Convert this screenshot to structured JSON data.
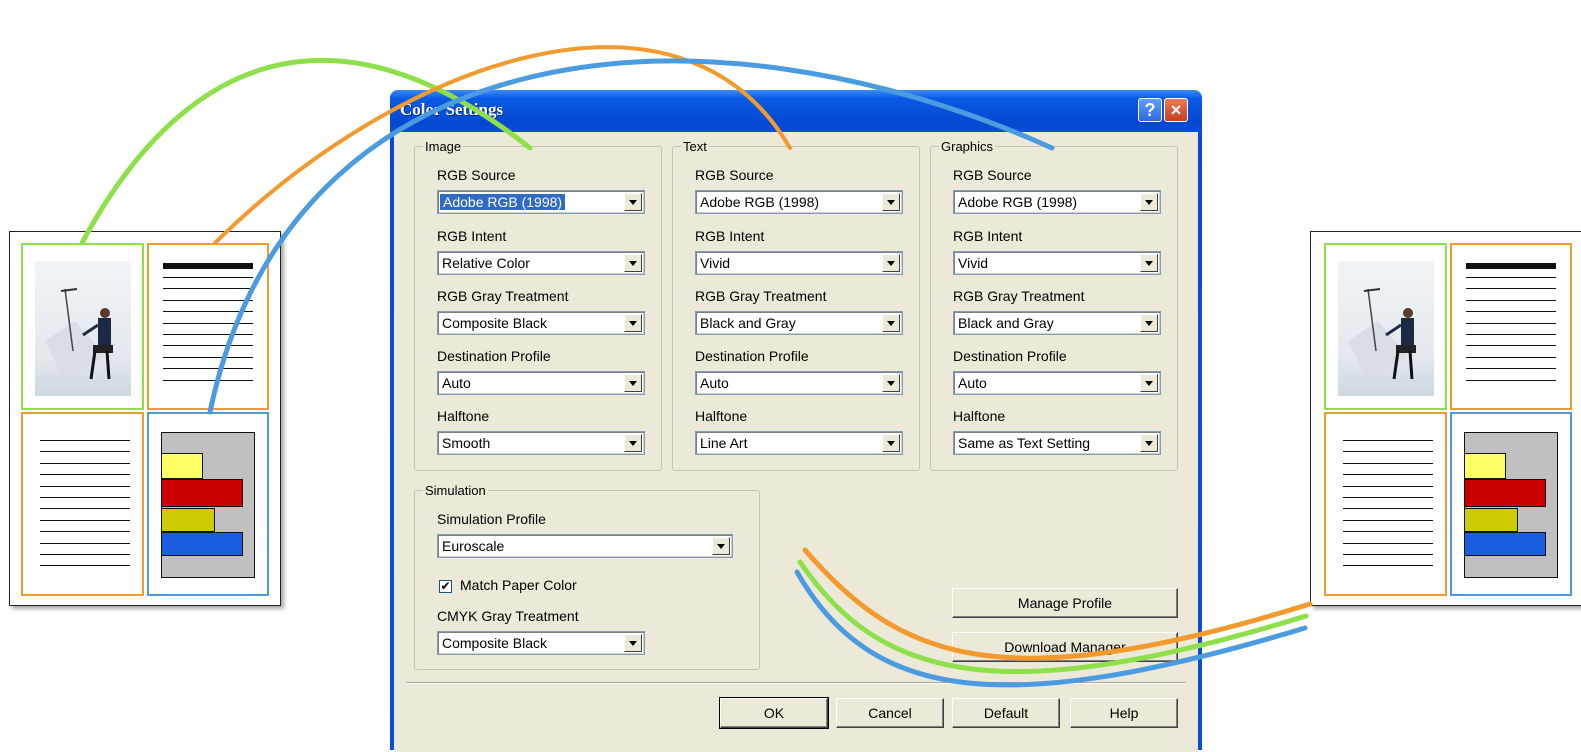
{
  "dialog": {
    "title": "Color Settings",
    "help_icon": "?",
    "close_icon": "×"
  },
  "groups": {
    "image": {
      "legend": "Image",
      "rgb_source_label": "RGB Source",
      "rgb_source_value": "Adobe RGB (1998)",
      "rgb_intent_label": "RGB Intent",
      "rgb_intent_value": "Relative Color",
      "gray_treatment_label": "RGB Gray Treatment",
      "gray_treatment_value": "Composite Black",
      "dest_profile_label": "Destination Profile",
      "dest_profile_value": "Auto",
      "halftone_label": "Halftone",
      "halftone_value": "Smooth"
    },
    "text": {
      "legend": "Text",
      "rgb_source_label": "RGB Source",
      "rgb_source_value": "Adobe RGB (1998)",
      "rgb_intent_label": "RGB Intent",
      "rgb_intent_value": "Vivid",
      "gray_treatment_label": "RGB Gray Treatment",
      "gray_treatment_value": "Black and Gray",
      "dest_profile_label": "Destination Profile",
      "dest_profile_value": "Auto",
      "halftone_label": "Halftone",
      "halftone_value": "Line Art"
    },
    "graphics": {
      "legend": "Graphics",
      "rgb_source_label": "RGB Source",
      "rgb_source_value": "Adobe RGB (1998)",
      "rgb_intent_label": "RGB Intent",
      "rgb_intent_value": "Vivid",
      "gray_treatment_label": "RGB Gray Treatment",
      "gray_treatment_value": "Black and Gray",
      "dest_profile_label": "Destination Profile",
      "dest_profile_value": "Auto",
      "halftone_label": "Halftone",
      "halftone_value": "Same as Text Setting"
    },
    "simulation": {
      "legend": "Simulation",
      "profile_label": "Simulation Profile",
      "profile_value": "Euroscale",
      "match_paper_label": "Match Paper Color",
      "match_paper_checked": true,
      "cmyk_gray_label": "CMYK Gray Treatment",
      "cmyk_gray_value": "Composite Black"
    }
  },
  "buttons": {
    "manage_profile": "Manage Profile",
    "download_manager": "Download Manager",
    "ok": "OK",
    "cancel": "Cancel",
    "default": "Default",
    "help": "Help"
  },
  "colors": {
    "image_link": "#8de04a",
    "text_link": "#f29a2e",
    "graphics_link": "#4a9be0",
    "chart_bar_yellow": "#ffff66",
    "chart_bar_red": "#cc0000",
    "chart_bar_olive": "#cccc00",
    "chart_bar_blue": "#1a5ee0"
  }
}
